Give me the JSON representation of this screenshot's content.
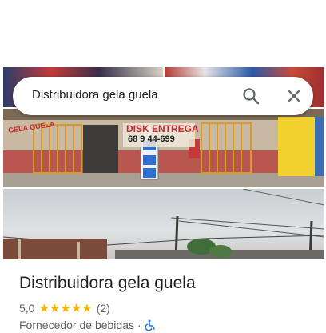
{
  "search": {
    "query": "Distribuidora gela guela"
  },
  "photos": {
    "store_sign_left": "GELA GUELA",
    "store_sign_right": "DISK ENTREGA",
    "store_phone": "68 9 44-699"
  },
  "place": {
    "title": "Distribuidora gela guela",
    "rating": "5,0",
    "stars": "★★★★★",
    "review_count": "(2)",
    "category": "Fornecedor de bebidas",
    "separator": "·"
  },
  "icons": {
    "search": "search-icon",
    "close": "close-icon",
    "accessibility": "wheelchair-accessible-icon"
  },
  "colors": {
    "star": "#f4b400",
    "accessibility": "#1a73e8",
    "title": "#202124",
    "secondary": "#5f6368"
  }
}
